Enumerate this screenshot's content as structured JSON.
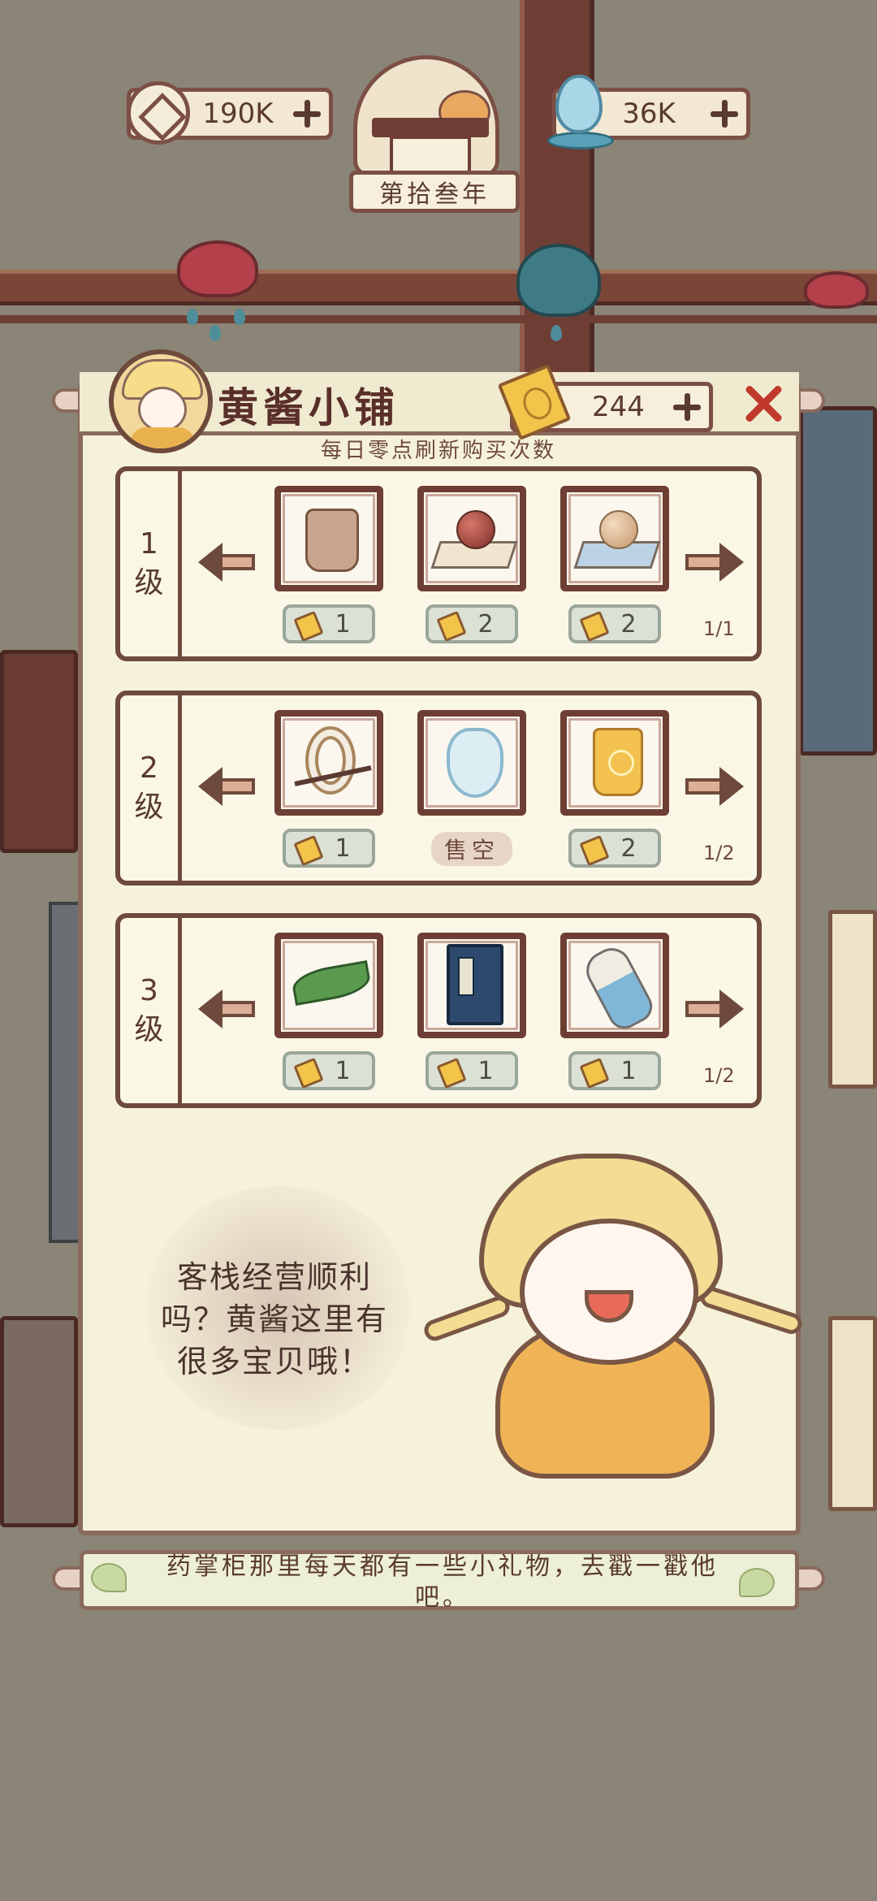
{
  "currencies": {
    "coins": {
      "icon": "copper-coin-icon",
      "value": "190K"
    },
    "water": {
      "icon": "water-drop-icon",
      "value": "36K"
    }
  },
  "year_banner": "第拾叁年",
  "shop": {
    "title": "黄酱小铺",
    "tickets": "244",
    "refresh_note": "每日零点刷新购买次数",
    "tiers": [
      {
        "label_num": "1",
        "label_suffix": "级",
        "count": "1/1",
        "items": [
          {
            "icon": "cloth-pouch-icon",
            "price": "1",
            "sold_out": false
          },
          {
            "icon": "red-bead-on-cloth-icon",
            "price": "2",
            "sold_out": false
          },
          {
            "icon": "pearl-on-cloth-icon",
            "price": "2",
            "sold_out": false
          }
        ]
      },
      {
        "label_num": "2",
        "label_suffix": "级",
        "count": "1/2",
        "items": [
          {
            "icon": "bracelet-rings-icon",
            "price": "1",
            "sold_out": false
          },
          {
            "icon": "blue-spirit-icon",
            "price": "",
            "sold_out": true
          },
          {
            "icon": "gold-pouch-icon",
            "price": "2",
            "sold_out": false
          }
        ]
      },
      {
        "label_num": "3",
        "label_suffix": "级",
        "count": "1/2",
        "items": [
          {
            "icon": "green-leaf-icon",
            "price": "1",
            "sold_out": false
          },
          {
            "icon": "blue-book-icon",
            "price": "1",
            "sold_out": false
          },
          {
            "icon": "potion-vial-icon",
            "price": "1",
            "sold_out": false
          }
        ]
      }
    ],
    "sold_out_label": "售空"
  },
  "dialog": {
    "line1": "客栈经营顺利",
    "line2": "吗？黄酱这里有",
    "line3": "很多宝贝哦！"
  },
  "tip": {
    "line1": "药掌柜那里每天都有一些小礼物，去戳一戳他",
    "line2": "吧。"
  },
  "colors": {
    "panel_bg": "#f6f2da",
    "frame": "#6e4a3c",
    "close": "#c0392b",
    "ticket": "#f2c44a"
  }
}
